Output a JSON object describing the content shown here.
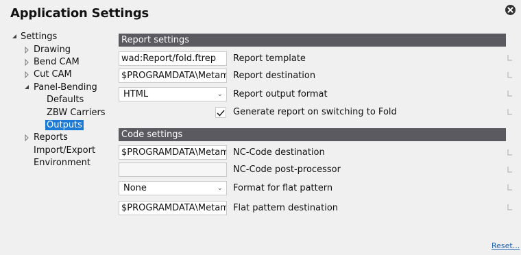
{
  "window": {
    "title": "Application Settings"
  },
  "tree": {
    "root": "Settings",
    "items": [
      "Drawing",
      "Bend CAM",
      "Cut CAM",
      "Panel-Bending",
      "Reports",
      "Import/Export",
      "Environment"
    ],
    "panel_bending_children": [
      "Defaults",
      "ZBW Carriers",
      "Outputs"
    ],
    "selected": "Outputs"
  },
  "report_settings": {
    "header": "Report settings",
    "template_value": "wad:Report/fold.ftrep",
    "template_label": "Report template",
    "destination_value": "$PROGRAMDATA\\Metam",
    "destination_label": "Report destination",
    "format_value": "HTML",
    "format_label": "Report output format",
    "generate_checked": true,
    "generate_label": "Generate report on switching to Fold"
  },
  "code_settings": {
    "header": "Code settings",
    "nc_destination_value": "$PROGRAMDATA\\Metam",
    "nc_destination_label": "NC-Code destination",
    "post_processor_value": "",
    "post_processor_label": "NC-Code post-processor",
    "flat_format_value": "None",
    "flat_format_label": "Format for flat pattern",
    "flat_destination_value": "$PROGRAMDATA\\Metam",
    "flat_destination_label": "Flat pattern destination"
  },
  "footer": {
    "reset_label": "Reset..."
  },
  "colors": {
    "section_header": "#5a5a60",
    "selection": "#1b7ad6",
    "link": "#1b5fb0"
  },
  "icons": {
    "close": "close-circle-icon",
    "expanded": "triangle-down-icon",
    "collapsed": "triangle-right-icon",
    "check": "checkmark-icon",
    "pin": "pin-corner-icon"
  }
}
